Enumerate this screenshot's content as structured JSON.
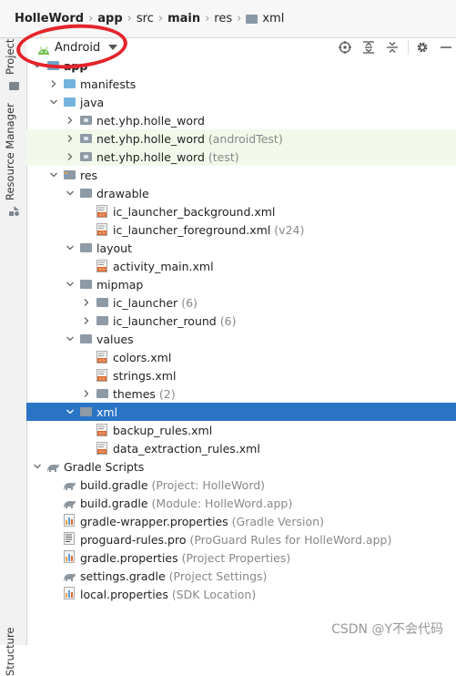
{
  "breadcrumb": [
    {
      "label": "HolleWord",
      "bold": true
    },
    {
      "label": "app",
      "bold": true
    },
    {
      "label": "src",
      "bold": false
    },
    {
      "label": "main",
      "bold": true
    },
    {
      "label": "res",
      "bold": false
    },
    {
      "label": "xml",
      "bold": false,
      "folder": true
    }
  ],
  "side_tabs": {
    "project": "Project",
    "resource_manager": "Resource Manager",
    "structure": "Structure"
  },
  "toolbar": {
    "view_selector": "Android",
    "icons": [
      "crosshair-icon",
      "expand-all-icon",
      "collapse-all-icon",
      "gear-icon",
      "minimize-icon"
    ]
  },
  "tree": [
    {
      "level": 1,
      "label": "app",
      "icon": "folder-app",
      "expanded": true,
      "bold": true
    },
    {
      "level": 2,
      "label": "manifests",
      "icon": "folder-blue",
      "expanded": false
    },
    {
      "level": 2,
      "label": "java",
      "icon": "folder-blue",
      "expanded": true
    },
    {
      "level": 3,
      "label": "net.yhp.holle_word",
      "icon": "package",
      "expanded": false
    },
    {
      "level": 3,
      "label": "net.yhp.holle_word",
      "hint": "(androidTest)",
      "icon": "package",
      "expanded": false,
      "green": true
    },
    {
      "level": 3,
      "label": "net.yhp.holle_word",
      "hint": "(test)",
      "icon": "package",
      "expanded": false,
      "green": true
    },
    {
      "level": 2,
      "label": "res",
      "icon": "folder-res",
      "expanded": true
    },
    {
      "level": 3,
      "label": "drawable",
      "icon": "folder-grey",
      "expanded": true
    },
    {
      "level": 4,
      "label": "ic_launcher_background.xml",
      "icon": "xml",
      "leaf": true
    },
    {
      "level": 4,
      "label": "ic_launcher_foreground.xml",
      "hint": "(v24)",
      "icon": "xml",
      "leaf": true
    },
    {
      "level": 3,
      "label": "layout",
      "icon": "folder-grey",
      "expanded": true
    },
    {
      "level": 4,
      "label": "activity_main.xml",
      "icon": "xml",
      "leaf": true
    },
    {
      "level": 3,
      "label": "mipmap",
      "icon": "folder-grey",
      "expanded": true
    },
    {
      "level": 4,
      "label": "ic_launcher",
      "hint": "(6)",
      "icon": "folder-grey",
      "expanded": false
    },
    {
      "level": 4,
      "label": "ic_launcher_round",
      "hint": "(6)",
      "icon": "folder-grey",
      "expanded": false
    },
    {
      "level": 3,
      "label": "values",
      "icon": "folder-grey",
      "expanded": true
    },
    {
      "level": 4,
      "label": "colors.xml",
      "icon": "xml",
      "leaf": true
    },
    {
      "level": 4,
      "label": "strings.xml",
      "icon": "xml",
      "leaf": true
    },
    {
      "level": 4,
      "label": "themes",
      "hint": "(2)",
      "icon": "folder-grey",
      "expanded": false
    },
    {
      "level": 3,
      "label": "xml",
      "icon": "folder-grey",
      "expanded": true,
      "selected": true
    },
    {
      "level": 4,
      "label": "backup_rules.xml",
      "icon": "xml",
      "leaf": true
    },
    {
      "level": 4,
      "label": "data_extraction_rules.xml",
      "icon": "xml",
      "leaf": true
    },
    {
      "level": 1,
      "label": "Gradle Scripts",
      "icon": "gradle",
      "expanded": true
    },
    {
      "level": 2,
      "label": "build.gradle",
      "hint": "(Project: HolleWord)",
      "icon": "gradle",
      "leaf": true
    },
    {
      "level": 2,
      "label": "build.gradle",
      "hint": "(Module: HolleWord.app)",
      "icon": "gradle",
      "leaf": true
    },
    {
      "level": 2,
      "label": "gradle-wrapper.properties",
      "hint": "(Gradle Version)",
      "icon": "properties",
      "leaf": true
    },
    {
      "level": 2,
      "label": "proguard-rules.pro",
      "hint": "(ProGuard Rules for HolleWord.app)",
      "icon": "proguard",
      "leaf": true
    },
    {
      "level": 2,
      "label": "gradle.properties",
      "hint": "(Project Properties)",
      "icon": "properties",
      "leaf": true
    },
    {
      "level": 2,
      "label": "settings.gradle",
      "hint": "(Project Settings)",
      "icon": "gradle",
      "leaf": true
    },
    {
      "level": 2,
      "label": "local.properties",
      "hint": "(SDK Location)",
      "icon": "properties",
      "leaf": true
    }
  ],
  "watermark": "CSDN @Y不会代码",
  "colors": {
    "selection": "#2a74c5",
    "green_row": "#f3f9ea",
    "annotation": "#e5232a"
  }
}
